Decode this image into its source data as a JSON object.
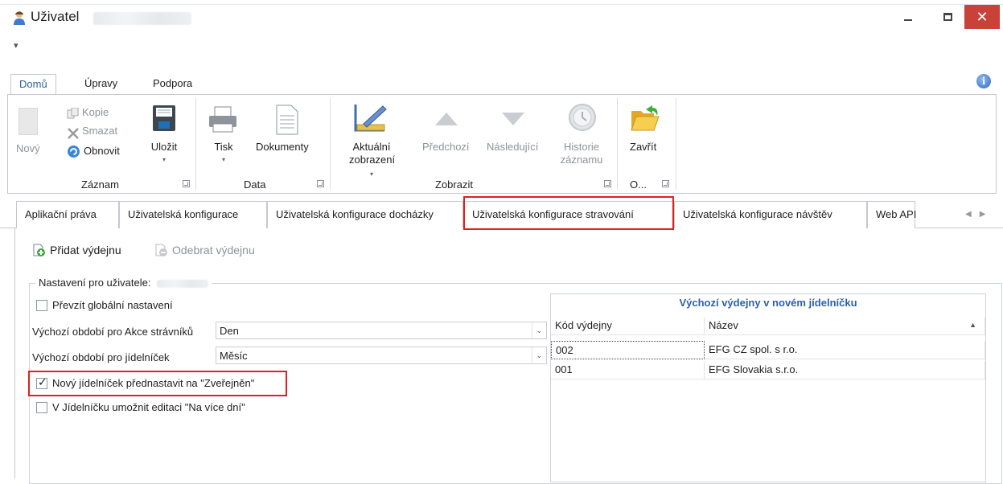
{
  "window": {
    "title": "Uživatel",
    "close_symbol": "✕"
  },
  "qat": {
    "dropdown_symbol": "▾"
  },
  "ribbon_tabs": [
    "Domů",
    "Úpravy",
    "Podpora"
  ],
  "info_icon_label": "i",
  "ribbon": {
    "groups": {
      "zaznam": "Záznam",
      "data": "Data",
      "zobrazit": "Zobrazit",
      "o": "O..."
    },
    "buttons": {
      "novy": "Nový",
      "kopie": "Kopie",
      "smazat": "Smazat",
      "obnovit": "Obnovit",
      "ulozit": "Uložit",
      "tisk": "Tisk",
      "dokumenty": "Dokumenty",
      "aktualni_1": "Aktuální",
      "aktualni_2": "zobrazení",
      "predchozi": "Předchozí",
      "nasledujici": "Následující",
      "historie_1": "Historie",
      "historie_2": "záznamu",
      "zavrit": "Zavřít"
    }
  },
  "doc_tabs": [
    "Aplikační práva",
    "Uživatelská konfigurace",
    "Uživatelská konfigurace docházky",
    "Uživatelská konfigurace stravování",
    "Uživatelská konfigurace návštěv",
    "Web API"
  ],
  "toolbar": {
    "add": "Přidat výdejnu",
    "remove": "Odebrat výdejnu"
  },
  "settings": {
    "group_title": "Nastavení pro uživatele:",
    "prevzit": "Převzít globální nastavení",
    "akce_label": "Výchozí období pro Akce strávníků",
    "akce_value": "Den",
    "jidelnicek_label": "Výchozí období pro jídelníček",
    "jidelnicek_value": "Měsíc",
    "prednastavit": "Nový jídelníček přednastavit na \"Zveřejněn\"",
    "editace": "V Jídelníčku umožnit editaci \"Na více dní\""
  },
  "grid": {
    "title": "Výchozí výdejny v novém jídelníčku",
    "headers": [
      "Kód výdejny",
      "Název"
    ],
    "rows": [
      [
        "002",
        "EFG CZ spol. s r.o."
      ],
      [
        "001",
        "EFG Slovakia s.r.o."
      ]
    ]
  },
  "colors": {
    "accent": "#2f5fa3",
    "highlight": "#e02020",
    "close": "#c8423a"
  }
}
